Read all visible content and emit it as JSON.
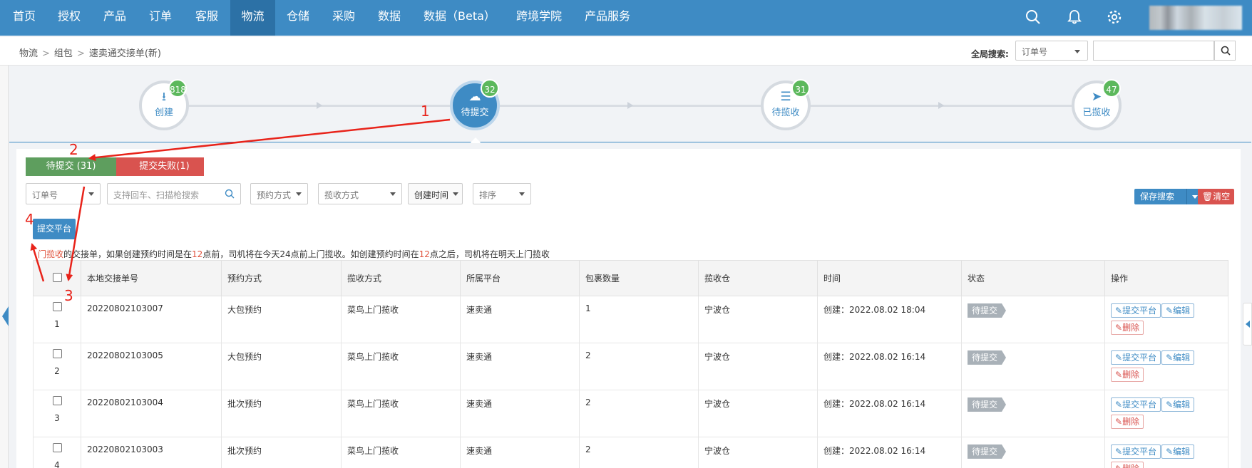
{
  "nav": {
    "items": [
      "首页",
      "授权",
      "产品",
      "订单",
      "客服",
      "物流",
      "仓储",
      "采购",
      "数据",
      "数据（Beta）",
      "跨境学院",
      "产品服务"
    ],
    "active": "物流",
    "icons": [
      "search-icon",
      "bell-icon",
      "gear-icon"
    ],
    "color": "#3e8bc4"
  },
  "breadcrumb": {
    "items": [
      "物流",
      "组包",
      "速卖通交接单(新)"
    ],
    "global_search_label": "全局搜索:",
    "global_search_type": "订单号"
  },
  "steps": [
    {
      "label": "创建",
      "count": "818",
      "icon": "download-icon"
    },
    {
      "label": "待提交",
      "count": "32",
      "icon": "cloud-upload-icon",
      "active": true
    },
    {
      "label": "待揽收",
      "count": "31",
      "icon": "list-icon"
    },
    {
      "label": "已揽收",
      "count": "47",
      "icon": "paper-plane-icon"
    }
  ],
  "tabs": {
    "pending": "待提交 (31)",
    "failed": "提交失败(1)"
  },
  "filters": {
    "order_no": "订单号",
    "search_placeholder": "支持回车、扫描枪搜索",
    "booking_method": "预约方式",
    "pickup_method": "揽收方式",
    "created_time": "创建时间",
    "sort": "排序"
  },
  "actions": {
    "save_search": "保存搜索",
    "clear": "清空",
    "submit_platform": "提交平台"
  },
  "notice": {
    "p1": "门揽收",
    "p2": "的交接单，如果创建预约时间是在",
    "h1": "12",
    "p3": "点前，司机将在今天24点前上门揽收。如创建预约时间在",
    "h2": "12",
    "p4": "点之后，司机将在明天上门揽收"
  },
  "table": {
    "columns": [
      "本地交接单号",
      "预约方式",
      "揽收方式",
      "所属平台",
      "包裹数量",
      "揽收仓",
      "时间",
      "状态",
      "操作"
    ],
    "rows": [
      {
        "num": "1",
        "id": "20220802103007",
        "booking": "大包预约",
        "pickup": "菜鸟上门揽收",
        "platform": "速卖通",
        "count": "1",
        "warehouse": "宁波仓",
        "time": "创建：2022.08.02 18:04",
        "status": "待提交"
      },
      {
        "num": "2",
        "id": "20220802103005",
        "booking": "大包预约",
        "pickup": "菜鸟上门揽收",
        "platform": "速卖通",
        "count": "2",
        "warehouse": "宁波仓",
        "time": "创建：2022.08.02 16:14",
        "status": "待提交"
      },
      {
        "num": "3",
        "id": "20220802103004",
        "booking": "批次预约",
        "pickup": "菜鸟上门揽收",
        "platform": "速卖通",
        "count": "2",
        "warehouse": "宁波仓",
        "time": "创建：2022.08.02 16:14",
        "status": "待提交"
      },
      {
        "num": "4",
        "id": "20220802103003",
        "booking": "批次预约",
        "pickup": "菜鸟上门揽收",
        "platform": "速卖通",
        "count": "2",
        "warehouse": "宁波仓",
        "time": "创建：2022.08.02 16:14",
        "status": "待提交"
      }
    ],
    "op_submit": "提交平台",
    "op_edit": "编辑",
    "op_delete": "删除"
  },
  "annotations": [
    "1",
    "2",
    "3",
    "4"
  ],
  "colors": {
    "accent": "#3e8bc4",
    "success": "#5cb85c",
    "danger": "#d9534f",
    "annotation": "#e8231a"
  }
}
